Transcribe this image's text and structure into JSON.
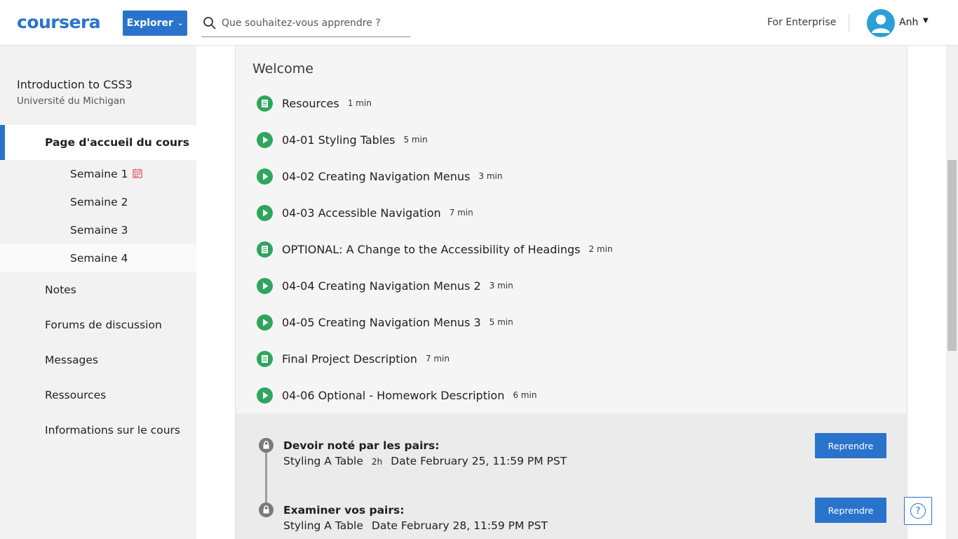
{
  "header": {
    "logo": "coursera",
    "explore_label": "Explorer",
    "search_placeholder": "Que souhaitez-vous apprendre ?",
    "enterprise_label": "For Enterprise",
    "user_name": "Anh"
  },
  "sidebar": {
    "course_title": "Introduction to CSS3",
    "university": "Université du Michigan",
    "home_label": "Page d'accueil du cours",
    "weeks": [
      {
        "label": "Semaine 1",
        "has_calendar_icon": true
      },
      {
        "label": "Semaine 2"
      },
      {
        "label": "Semaine 3"
      },
      {
        "label": "Semaine 4",
        "active": true
      }
    ],
    "items": [
      "Notes",
      "Forums de discussion",
      "Messages",
      "Ressources",
      "Informations sur le cours"
    ]
  },
  "main": {
    "section_title": "Welcome",
    "items": [
      {
        "type": "reading",
        "icon": "reading-icon",
        "title": "Resources",
        "duration": "1 min"
      },
      {
        "type": "video",
        "icon": "play-icon",
        "title": "04-01 Styling Tables",
        "duration": "5 min"
      },
      {
        "type": "video",
        "icon": "play-icon",
        "title": "04-02 Creating Navigation Menus",
        "duration": "3 min"
      },
      {
        "type": "video",
        "icon": "play-icon",
        "title": "04-03 Accessible Navigation",
        "duration": "7 min"
      },
      {
        "type": "reading",
        "icon": "reading-icon",
        "title": "OPTIONAL: A Change to the Accessibility of Headings",
        "duration": "2 min"
      },
      {
        "type": "video",
        "icon": "play-icon",
        "title": "04-04 Creating Navigation Menus 2",
        "duration": "3 min"
      },
      {
        "type": "video",
        "icon": "play-icon",
        "title": "04-05 Creating Navigation Menus 3",
        "duration": "5 min"
      },
      {
        "type": "reading",
        "icon": "reading-icon",
        "title": "Final Project Description",
        "duration": "7 min"
      },
      {
        "type": "video",
        "icon": "play-icon",
        "title": "04-06 Optional - Homework Description",
        "duration": "6 min"
      }
    ],
    "assignments": [
      {
        "title": "Devoir noté par les pairs:",
        "name": "Styling A Table",
        "hours": "2h",
        "due": "Date February 25, 11:59 PM PST",
        "button": "Reprendre"
      },
      {
        "title": "Examiner vos pairs:",
        "name": "Styling A Table",
        "hours": "",
        "due": "Date February 28, 11:59 PM PST",
        "button": "Reprendre"
      }
    ]
  },
  "help_label": "?",
  "colors": {
    "brand": "#2a73cc",
    "item_green": "#2fa55e",
    "sidebar_bg": "#f2f2f2"
  }
}
